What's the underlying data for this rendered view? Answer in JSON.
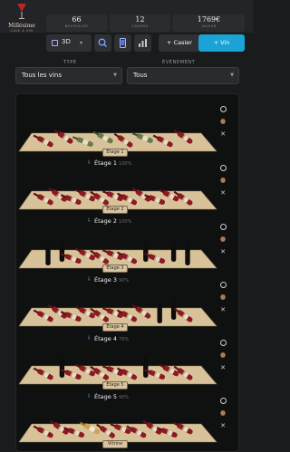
{
  "header": {
    "brand": "Millésime",
    "brand_sub": "CAVE À VIN",
    "stats": [
      {
        "value": "66",
        "label": "BOUTEILLES"
      },
      {
        "value": "12",
        "label": "CASIERS"
      },
      {
        "value": "1769€",
        "label": "VALEUR"
      }
    ]
  },
  "toolbar": {
    "view_mode": "3D",
    "add_casier_label": "+ Casier",
    "add_vin_label": "+ Vin"
  },
  "filters": {
    "type_label": "TYPE",
    "type_value": "Tous les vins",
    "event_label": "ÉVÉNEMENT",
    "event_value": "Tous"
  },
  "shelves": [
    {
      "name": "Étage 1",
      "tag": "",
      "pct": ""
    },
    {
      "name": "Étage 2",
      "tag": "Étage 1",
      "pct": "100%"
    },
    {
      "name": "Étage 3",
      "tag": "Étage 2",
      "pct": "100%"
    },
    {
      "name": "Étage 4",
      "tag": "Étage 3",
      "pct": "90%"
    },
    {
      "name": "Étage 5",
      "tag": "Étage 4",
      "pct": "70%"
    },
    {
      "name": "Vitrine",
      "tag": "Étage 5",
      "pct": "90%"
    }
  ],
  "colors": {
    "accent": "#1ba3d5",
    "bottle_red": "#8b1a24",
    "bottle_green": "#6a7a4a",
    "bottle_rose": "#d4a050",
    "shelf": "#d8c29a"
  }
}
